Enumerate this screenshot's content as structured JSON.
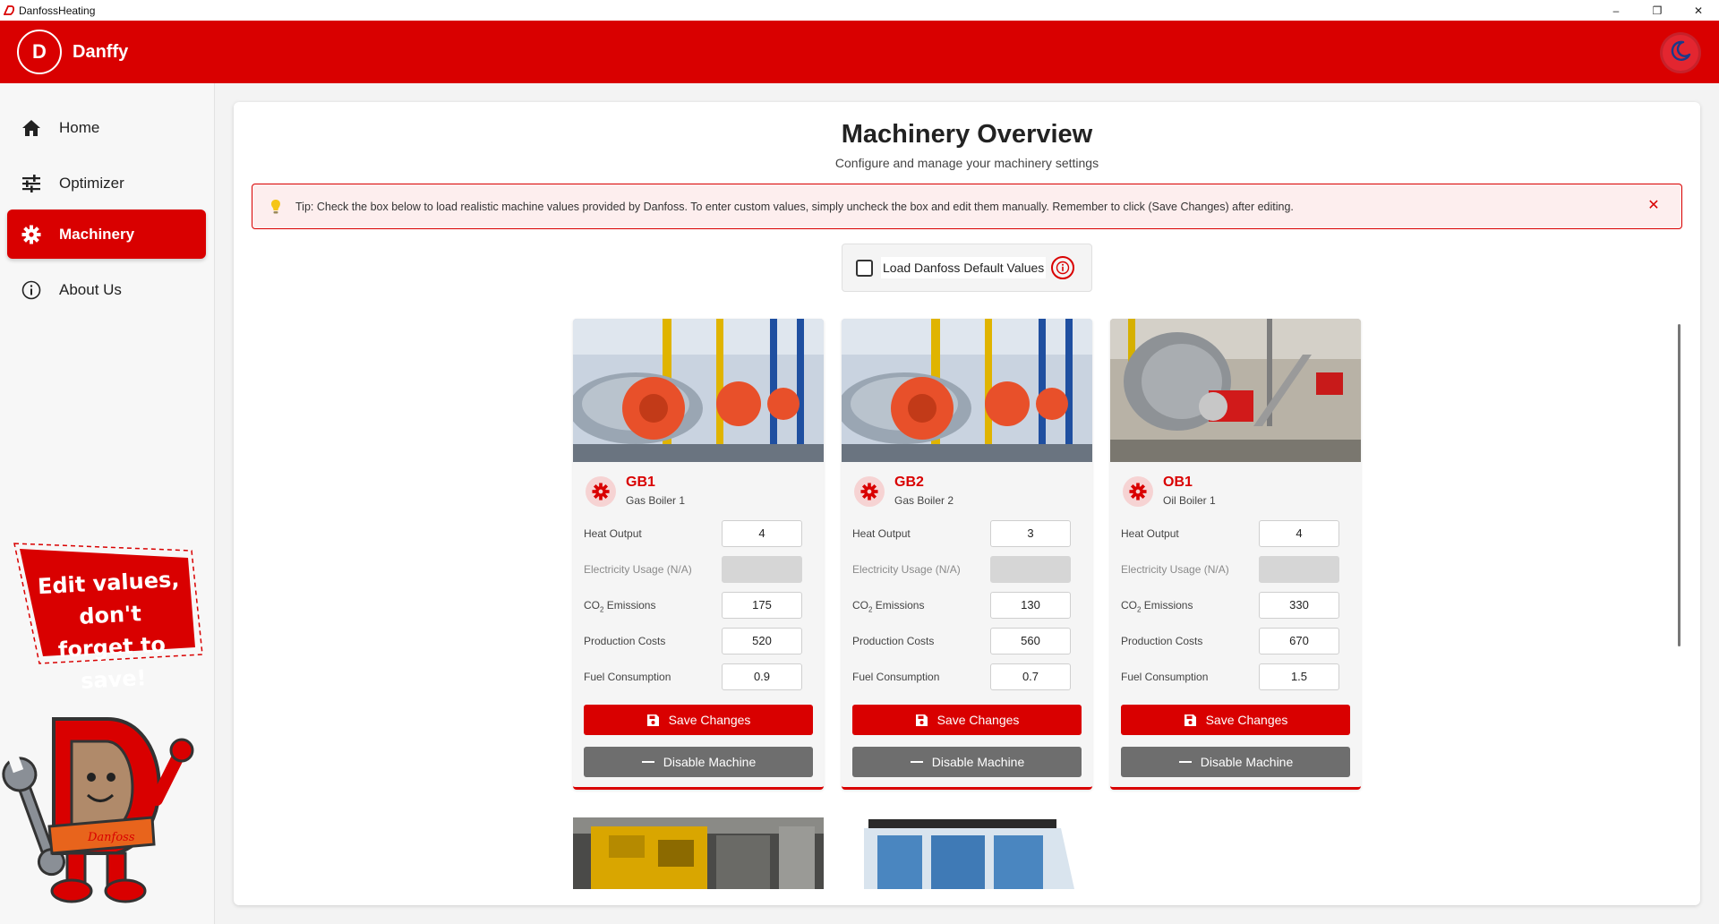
{
  "window": {
    "title": "DanfossHeating",
    "minimize": "–",
    "maximize": "❐",
    "close": "✕"
  },
  "brand": {
    "initial": "D",
    "name": "Danffy"
  },
  "sidebar": {
    "items": [
      {
        "label": "Home",
        "icon": "home-icon",
        "active": false
      },
      {
        "label": "Optimizer",
        "icon": "sliders-icon",
        "active": false
      },
      {
        "label": "Machinery",
        "icon": "gear-icon",
        "active": true
      },
      {
        "label": "About Us",
        "icon": "info-icon",
        "active": false
      }
    ],
    "sticker_line1": "Edit values, don't",
    "sticker_line2": "forget to save!",
    "mascot_logo": "Danfoss"
  },
  "page": {
    "title": "Machinery Overview",
    "subtitle": "Configure and manage your machinery settings",
    "tip": "Tip: Check the box below to load realistic machine values provided by Danfoss. To enter custom values, simply uncheck the box and edit them manually. Remember to click (Save Changes) after editing.",
    "tip_close": "✕",
    "defaults_label": "Load Danfoss Default Values",
    "defaults_checked": false
  },
  "labels": {
    "heat_output": "Heat Output",
    "electricity_usage": "Electricity Usage (N/A)",
    "co2_prefix": "CO",
    "co2_sub": "2",
    "co2_suffix": " Emissions",
    "production_costs": "Production Costs",
    "fuel_consumption": "Fuel Consumption",
    "save": "Save Changes",
    "disable": "Disable Machine"
  },
  "machines": [
    {
      "code": "GB1",
      "name": "Gas Boiler 1",
      "heat_output": "4",
      "electricity_usage": "",
      "co2_emissions": "175",
      "production_costs": "520",
      "fuel_consumption": "0.9"
    },
    {
      "code": "GB2",
      "name": "Gas Boiler 2",
      "heat_output": "3",
      "electricity_usage": "",
      "co2_emissions": "130",
      "production_costs": "560",
      "fuel_consumption": "0.7"
    },
    {
      "code": "OB1",
      "name": "Oil Boiler 1",
      "heat_output": "4",
      "electricity_usage": "",
      "co2_emissions": "330",
      "production_costs": "670",
      "fuel_consumption": "1.5"
    }
  ],
  "colors": {
    "brand_red": "#d90000",
    "disabled_gray": "#6e6e6e",
    "tip_bg": "#fdeeee"
  }
}
